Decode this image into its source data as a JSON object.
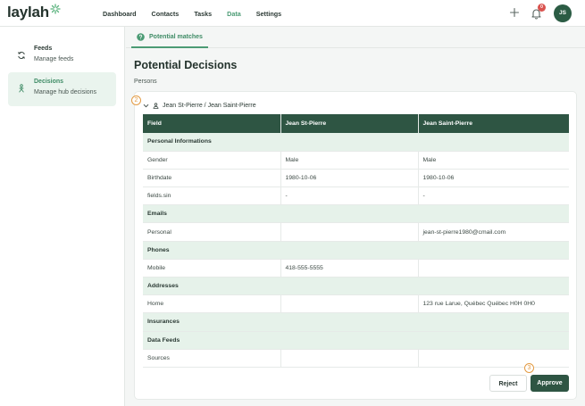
{
  "app": {
    "logo_text": "laylah"
  },
  "nav": {
    "items": [
      {
        "label": "Dashboard",
        "active": false
      },
      {
        "label": "Contacts",
        "active": false
      },
      {
        "label": "Tasks",
        "active": false
      },
      {
        "label": "Data",
        "active": true
      },
      {
        "label": "Settings",
        "active": false
      }
    ],
    "notifications_count": "0",
    "avatar_initials": "JS"
  },
  "sidebar": {
    "items": [
      {
        "title": "Feeds",
        "subtitle": "Manage feeds",
        "icon": "refresh-icon",
        "active": false
      },
      {
        "title": "Decisions",
        "subtitle": "Manage hub decisions",
        "icon": "person-split-icon",
        "active": true
      }
    ]
  },
  "tabs": [
    {
      "label": "Potential matches",
      "icon": "question-circle-icon"
    }
  ],
  "page": {
    "title": "Potential Decisions",
    "section_label": "Persons",
    "group_title": "Jean St-Pierre / Jean Saint-Pierre",
    "markers": {
      "group": "2",
      "approve": "3"
    }
  },
  "table": {
    "headers": [
      "Field",
      "Jean St-Pierre",
      "Jean Saint-Pierre"
    ],
    "rows": [
      {
        "type": "section",
        "cells": [
          "Personal Informations",
          "",
          ""
        ]
      },
      {
        "type": "row",
        "cells": [
          "Gender",
          "Male",
          "Male"
        ]
      },
      {
        "type": "row",
        "cells": [
          "Birthdate",
          "1980-10-06",
          "1980-10-06"
        ]
      },
      {
        "type": "row",
        "cells": [
          "fields.sin",
          "-",
          "-"
        ]
      },
      {
        "type": "section",
        "cells": [
          "Emails",
          "",
          ""
        ]
      },
      {
        "type": "row",
        "cells": [
          "Personal",
          "",
          "jean-st-pierre1980@cmail.com"
        ]
      },
      {
        "type": "section",
        "cells": [
          "Phones",
          "",
          ""
        ]
      },
      {
        "type": "row",
        "cells": [
          "Mobile",
          "418-555-5555",
          ""
        ]
      },
      {
        "type": "section",
        "cells": [
          "Addresses",
          "",
          ""
        ]
      },
      {
        "type": "row",
        "cells": [
          "Home",
          "",
          "123 rue Larue, Québec Québec H0H 0H0"
        ]
      },
      {
        "type": "section",
        "cells": [
          "Insurances",
          "",
          ""
        ]
      },
      {
        "type": "section",
        "cells": [
          "Data Feeds",
          "",
          ""
        ]
      },
      {
        "type": "row",
        "cells": [
          "Sources",
          "",
          ""
        ]
      }
    ]
  },
  "actions": {
    "reject_label": "Reject",
    "approve_label": "Approve"
  },
  "colors": {
    "brand": "#2e5543",
    "accent": "#4b9b74",
    "section_bg": "#e6f2ea",
    "marker": "#e39b44"
  }
}
